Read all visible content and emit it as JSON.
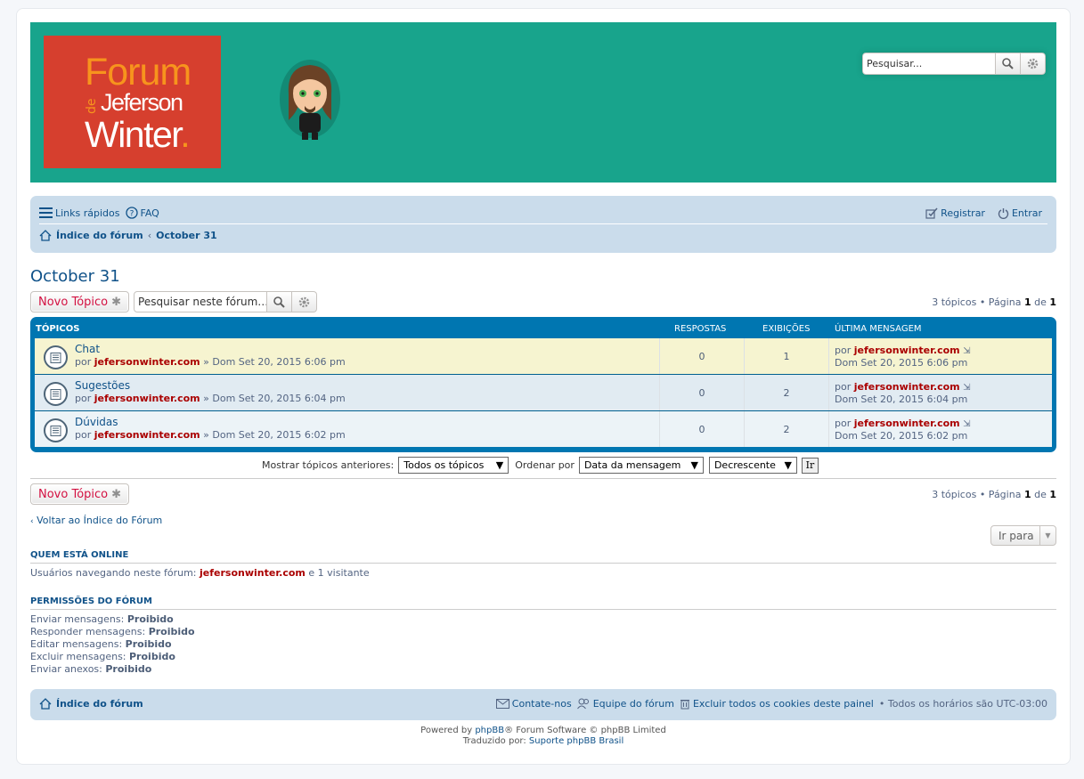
{
  "header": {
    "logo": {
      "line1": "Forum",
      "line2_prefix": "de",
      "line2": "Jeferson",
      "line3": "Winter",
      "dot": "."
    },
    "search_placeholder": "Pesquisar..."
  },
  "nav": {
    "quick_links": "Links rápidos",
    "faq": "FAQ",
    "register": "Registrar",
    "login": "Entrar",
    "breadcrumb_home": "Índice do fórum",
    "breadcrumb_forum": "October 31"
  },
  "forum": {
    "title": "October 31",
    "new_topic": "Novo Tópico",
    "search_placeholder": "Pesquisar neste fórum…",
    "pagination": {
      "count_text": "3 tópicos • Página ",
      "page": "1",
      "of": " de ",
      "total": "1"
    }
  },
  "table": {
    "headers": {
      "topics": "Tópicos",
      "replies": "Respostas",
      "views": "Exibições",
      "last_post": "Última mensagem"
    },
    "by": "por",
    "rows": [
      {
        "title": "Chat",
        "author": "jefersonwinter.com",
        "date": "» Dom Set 20, 2015 6:06 pm",
        "replies": "0",
        "views": "1",
        "last_author": "jefersonwinter.com",
        "last_date": "Dom Set 20, 2015 6:06 pm"
      },
      {
        "title": "Sugestões",
        "author": "jefersonwinter.com",
        "date": "» Dom Set 20, 2015 6:04 pm",
        "replies": "0",
        "views": "2",
        "last_author": "jefersonwinter.com",
        "last_date": "Dom Set 20, 2015 6:04 pm"
      },
      {
        "title": "Dúvidas",
        "author": "jefersonwinter.com",
        "date": "» Dom Set 20, 2015 6:02 pm",
        "replies": "0",
        "views": "2",
        "last_author": "jefersonwinter.com",
        "last_date": "Dom Set 20, 2015 6:02 pm"
      }
    ]
  },
  "sort": {
    "show_label": "Mostrar tópicos anteriores:",
    "show_value": "Todos os tópicos",
    "order_label": "Ordenar por",
    "order_value": "Data da mensagem",
    "direction_value": "Decrescente",
    "go": "Ir"
  },
  "back_link": "Voltar ao Índice do Fórum",
  "jump_to": "Ir para",
  "online": {
    "title": "Quem está online",
    "text_prefix": "Usuários navegando neste fórum: ",
    "user": "jefersonwinter.com",
    "text_suffix": " e 1 visitante"
  },
  "permissions": {
    "title": "Permissões do fórum",
    "items": [
      {
        "label": "Enviar mensagens: ",
        "value": "Proibido"
      },
      {
        "label": "Responder mensagens: ",
        "value": "Proibido"
      },
      {
        "label": "Editar mensagens: ",
        "value": "Proibido"
      },
      {
        "label": "Excluir mensagens: ",
        "value": "Proibido"
      },
      {
        "label": "Enviar anexos: ",
        "value": "Proibido"
      }
    ]
  },
  "footer": {
    "home": "Índice do fórum",
    "contact": "Contate-nos",
    "team": "Equipe do fórum",
    "delete_cookies": "Excluir todos os cookies deste painel",
    "timezone": "• Todos os horários são UTC-03:00",
    "powered_prefix": "Powered by ",
    "phpbb": "phpBB",
    "powered_suffix": "® Forum Software © phpBB Limited",
    "translated_prefix": "Traduzido por: ",
    "translator": "Suporte phpBB Brasil"
  },
  "colors": {
    "header_bg": "#18a48c",
    "logo_bg": "#d63f2e",
    "nav_bg": "#cadceb",
    "table_bg": "#0076b1",
    "link": "#105289",
    "author": "#aa0000"
  }
}
